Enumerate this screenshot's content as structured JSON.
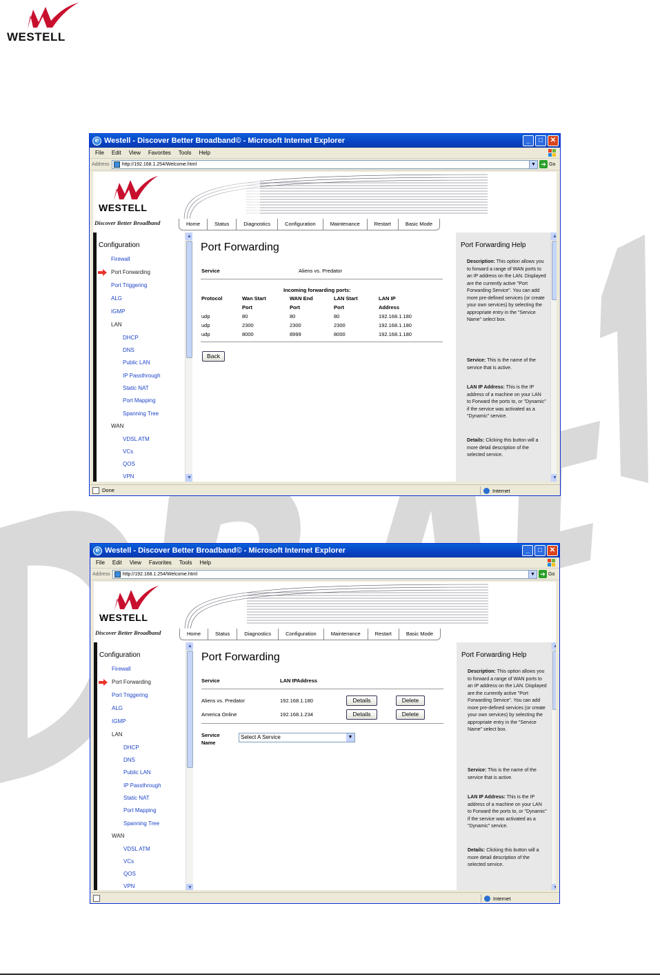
{
  "page": {
    "logo_text": "WESTELL"
  },
  "windows": [
    {
      "title": "Westell - Discover Better Broadband© - Microsoft Internet Explorer",
      "menu": [
        "File",
        "Edit",
        "View",
        "Favorites",
        "Tools",
        "Help"
      ],
      "address_label": "Address",
      "address_url": "http://192.168.1.254/Welcome.html",
      "go_label": "Go",
      "router_logo": "WESTELL",
      "tagline": "Discover Better Broadband",
      "tabs": [
        "Home",
        "Status",
        "Diagnostics",
        "Configuration",
        "Maintenance",
        "Restart",
        "Basic Mode"
      ],
      "nav_heading": "Configuration",
      "nav": {
        "firewall": "Firewall",
        "port_forwarding": "Port Forwarding",
        "port_triggering": "Port Triggering",
        "alg": "ALG",
        "igmp": "IGMP",
        "lan": "LAN",
        "dhcp": "DHCP",
        "dns": "DNS",
        "public_lan": "Public LAN",
        "ip_passthrough": "IP Passthrough",
        "static_nat": "Static NAT",
        "port_mapping": "Port Mapping",
        "spanning_tree": "Spanning Tree",
        "wan": "WAN",
        "vdsl_atm": "VDSL ATM",
        "vcs": "VCs",
        "qos": "QOS",
        "vpn": "VPN"
      },
      "content": {
        "title": "Port Forwarding",
        "service_label": "Service",
        "service_value": "Aliens vs. Predator",
        "incoming_heading": "Incoming forwarding ports:",
        "headers": {
          "protocol": "Protocol",
          "wan_start_1": "Wan Start",
          "wan_start_2": "Port",
          "wan_end_1": "WAN End",
          "wan_end_2": "Port",
          "lan_start_1": "LAN Start",
          "lan_start_2": "Port",
          "lan_ip_1": "LAN IP",
          "lan_ip_2": "Address"
        },
        "rows": [
          {
            "protocol": "udp",
            "wan_start": "80",
            "wan_end": "80",
            "lan_start": "80",
            "lan_ip": "192.168.1.180"
          },
          {
            "protocol": "udp",
            "wan_start": "2300",
            "wan_end": "2300",
            "lan_start": "2300",
            "lan_ip": "192.168.1.180"
          },
          {
            "protocol": "udp",
            "wan_start": "8000",
            "wan_end": "8999",
            "lan_start": "8000",
            "lan_ip": "192.168.1.180"
          }
        ],
        "back_button": "Back"
      },
      "help": {
        "title": "Port Forwarding Help",
        "description_label": "Description:",
        "description_text": " This option allows you to forward a range of WAN ports to an IP address on the LAN. Displayed are the currently active \"Port Forwarding Service\". You can add more pre-defined services (or create your own services) by selecting the appropriate entry in the \"Service Name\" select box.",
        "service_label": "Service:",
        "service_text": " This is the name of the service that is active.",
        "lanip_label": "LAN IP Address:",
        "lanip_text": " This is the IP address of a machine on your LAN to Forward the ports to, or \"Dynamic\" if the service was activated as a \"Dynamic\" service.",
        "details_label": "Details:",
        "details_text": " Clicking this button will a more detail description of the selected service."
      },
      "status_text": "Done",
      "status_zone": "Internet"
    },
    {
      "title": "Westell - Discover Better Broadband© - Microsoft Internet Explorer",
      "menu": [
        "File",
        "Edit",
        "View",
        "Favorites",
        "Tools",
        "Help"
      ],
      "address_label": "Address",
      "address_url": "http://192.168.1.254/Welcome.html",
      "go_label": "Go",
      "router_logo": "WESTELL",
      "tagline": "Discover Better Broadband",
      "tabs": [
        "Home",
        "Status",
        "Diagnostics",
        "Configuration",
        "Maintenance",
        "Restart",
        "Basic Mode"
      ],
      "nav_heading": "Configuration",
      "nav": {
        "firewall": "Firewall",
        "port_forwarding": "Port Forwarding",
        "port_triggering": "Port Triggering",
        "alg": "ALG",
        "igmp": "IGMP",
        "lan": "LAN",
        "dhcp": "DHCP",
        "dns": "DNS",
        "public_lan": "Public LAN",
        "ip_passthrough": "IP Passthrough",
        "static_nat": "Static NAT",
        "port_mapping": "Port Mapping",
        "spanning_tree": "Spanning Tree",
        "wan": "WAN",
        "vdsl_atm": "VDSL ATM",
        "vcs": "VCs",
        "qos": "QOS",
        "vpn": "VPN"
      },
      "content": {
        "title": "Port Forwarding",
        "service_header": "Service",
        "lanip_header": "LAN IPAddress",
        "services": [
          {
            "name": "Aliens vs. Predator",
            "ip": "192.168.1.180",
            "details": "Details",
            "delete": "Delete"
          },
          {
            "name": "America Online",
            "ip": "192.168.1.234",
            "details": "Details",
            "delete": "Delete"
          }
        ],
        "service_name_label_1": "Service",
        "service_name_label_2": "Name",
        "select_value": "Select A Service"
      },
      "help": {
        "title": "Port Forwarding Help",
        "description_label": "Description:",
        "description_text": " This option allows you to forward a range of WAN ports to an IP address on the LAN. Displayed are the currently active \"Port Forwarding Service\". You can add more pre-defined services (or create your own services) by selecting the appropriate entry in the \"Service Name\" select box.",
        "service_label": "Service:",
        "service_text": " This is the name of the service that is active.",
        "lanip_label": "LAN IP Address:",
        "lanip_text": " This is the IP address of a machine on your LAN to Forward the ports to, or \"Dynamic\" if the service was activated as a \"Dynamic\" service.",
        "details_label": "Details:",
        "details_text": " Clicking this button will a more detail description of the selected service."
      },
      "status_text": "",
      "status_zone": "Internet"
    }
  ]
}
